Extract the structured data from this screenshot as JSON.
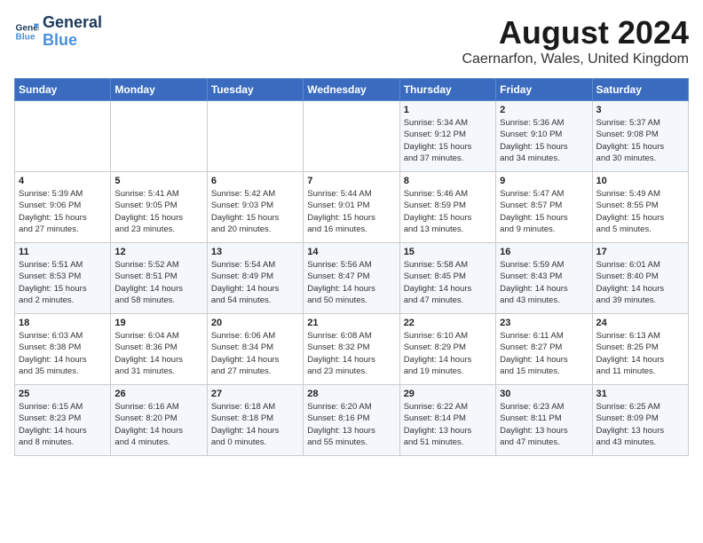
{
  "header": {
    "logo_line1": "General",
    "logo_line2": "Blue",
    "main_title": "August 2024",
    "sub_title": "Caernarfon, Wales, United Kingdom"
  },
  "days_of_week": [
    "Sunday",
    "Monday",
    "Tuesday",
    "Wednesday",
    "Thursday",
    "Friday",
    "Saturday"
  ],
  "weeks": [
    [
      {
        "day": "",
        "info": ""
      },
      {
        "day": "",
        "info": ""
      },
      {
        "day": "",
        "info": ""
      },
      {
        "day": "",
        "info": ""
      },
      {
        "day": "1",
        "info": "Sunrise: 5:34 AM\nSunset: 9:12 PM\nDaylight: 15 hours\nand 37 minutes."
      },
      {
        "day": "2",
        "info": "Sunrise: 5:36 AM\nSunset: 9:10 PM\nDaylight: 15 hours\nand 34 minutes."
      },
      {
        "day": "3",
        "info": "Sunrise: 5:37 AM\nSunset: 9:08 PM\nDaylight: 15 hours\nand 30 minutes."
      }
    ],
    [
      {
        "day": "4",
        "info": "Sunrise: 5:39 AM\nSunset: 9:06 PM\nDaylight: 15 hours\nand 27 minutes."
      },
      {
        "day": "5",
        "info": "Sunrise: 5:41 AM\nSunset: 9:05 PM\nDaylight: 15 hours\nand 23 minutes."
      },
      {
        "day": "6",
        "info": "Sunrise: 5:42 AM\nSunset: 9:03 PM\nDaylight: 15 hours\nand 20 minutes."
      },
      {
        "day": "7",
        "info": "Sunrise: 5:44 AM\nSunset: 9:01 PM\nDaylight: 15 hours\nand 16 minutes."
      },
      {
        "day": "8",
        "info": "Sunrise: 5:46 AM\nSunset: 8:59 PM\nDaylight: 15 hours\nand 13 minutes."
      },
      {
        "day": "9",
        "info": "Sunrise: 5:47 AM\nSunset: 8:57 PM\nDaylight: 15 hours\nand 9 minutes."
      },
      {
        "day": "10",
        "info": "Sunrise: 5:49 AM\nSunset: 8:55 PM\nDaylight: 15 hours\nand 5 minutes."
      }
    ],
    [
      {
        "day": "11",
        "info": "Sunrise: 5:51 AM\nSunset: 8:53 PM\nDaylight: 15 hours\nand 2 minutes."
      },
      {
        "day": "12",
        "info": "Sunrise: 5:52 AM\nSunset: 8:51 PM\nDaylight: 14 hours\nand 58 minutes."
      },
      {
        "day": "13",
        "info": "Sunrise: 5:54 AM\nSunset: 8:49 PM\nDaylight: 14 hours\nand 54 minutes."
      },
      {
        "day": "14",
        "info": "Sunrise: 5:56 AM\nSunset: 8:47 PM\nDaylight: 14 hours\nand 50 minutes."
      },
      {
        "day": "15",
        "info": "Sunrise: 5:58 AM\nSunset: 8:45 PM\nDaylight: 14 hours\nand 47 minutes."
      },
      {
        "day": "16",
        "info": "Sunrise: 5:59 AM\nSunset: 8:43 PM\nDaylight: 14 hours\nand 43 minutes."
      },
      {
        "day": "17",
        "info": "Sunrise: 6:01 AM\nSunset: 8:40 PM\nDaylight: 14 hours\nand 39 minutes."
      }
    ],
    [
      {
        "day": "18",
        "info": "Sunrise: 6:03 AM\nSunset: 8:38 PM\nDaylight: 14 hours\nand 35 minutes."
      },
      {
        "day": "19",
        "info": "Sunrise: 6:04 AM\nSunset: 8:36 PM\nDaylight: 14 hours\nand 31 minutes."
      },
      {
        "day": "20",
        "info": "Sunrise: 6:06 AM\nSunset: 8:34 PM\nDaylight: 14 hours\nand 27 minutes."
      },
      {
        "day": "21",
        "info": "Sunrise: 6:08 AM\nSunset: 8:32 PM\nDaylight: 14 hours\nand 23 minutes."
      },
      {
        "day": "22",
        "info": "Sunrise: 6:10 AM\nSunset: 8:29 PM\nDaylight: 14 hours\nand 19 minutes."
      },
      {
        "day": "23",
        "info": "Sunrise: 6:11 AM\nSunset: 8:27 PM\nDaylight: 14 hours\nand 15 minutes."
      },
      {
        "day": "24",
        "info": "Sunrise: 6:13 AM\nSunset: 8:25 PM\nDaylight: 14 hours\nand 11 minutes."
      }
    ],
    [
      {
        "day": "25",
        "info": "Sunrise: 6:15 AM\nSunset: 8:23 PM\nDaylight: 14 hours\nand 8 minutes."
      },
      {
        "day": "26",
        "info": "Sunrise: 6:16 AM\nSunset: 8:20 PM\nDaylight: 14 hours\nand 4 minutes."
      },
      {
        "day": "27",
        "info": "Sunrise: 6:18 AM\nSunset: 8:18 PM\nDaylight: 14 hours\nand 0 minutes."
      },
      {
        "day": "28",
        "info": "Sunrise: 6:20 AM\nSunset: 8:16 PM\nDaylight: 13 hours\nand 55 minutes."
      },
      {
        "day": "29",
        "info": "Sunrise: 6:22 AM\nSunset: 8:14 PM\nDaylight: 13 hours\nand 51 minutes."
      },
      {
        "day": "30",
        "info": "Sunrise: 6:23 AM\nSunset: 8:11 PM\nDaylight: 13 hours\nand 47 minutes."
      },
      {
        "day": "31",
        "info": "Sunrise: 6:25 AM\nSunset: 8:09 PM\nDaylight: 13 hours\nand 43 minutes."
      }
    ]
  ]
}
